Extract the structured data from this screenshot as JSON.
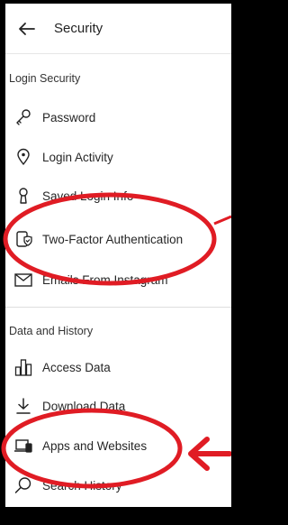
{
  "header": {
    "title": "Security"
  },
  "login_security": {
    "title": "Login Security",
    "items": [
      {
        "label": "Password",
        "icon": "key-icon"
      },
      {
        "label": "Login Activity",
        "icon": "location-pin-icon"
      },
      {
        "label": "Saved Login Info",
        "icon": "keyhole-icon"
      },
      {
        "label": "Two-Factor Authentication",
        "icon": "phone-shield-icon"
      },
      {
        "label": "Emails From Instagram",
        "icon": "envelope-icon"
      }
    ]
  },
  "data_history": {
    "title": "Data and History",
    "items": [
      {
        "label": "Access Data",
        "icon": "bar-chart-icon"
      },
      {
        "label": "Download Data",
        "icon": "download-icon"
      },
      {
        "label": "Apps and Websites",
        "icon": "laptop-phone-icon"
      },
      {
        "label": "Search History",
        "icon": "search-icon"
      }
    ]
  },
  "colors": {
    "annotation": "#e01c24",
    "text": "#262626"
  }
}
